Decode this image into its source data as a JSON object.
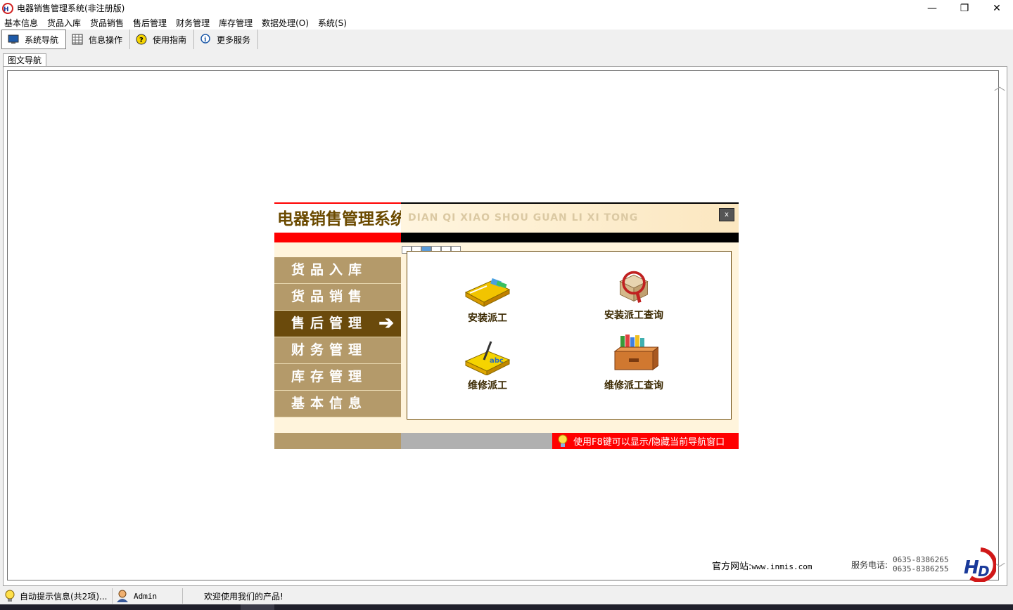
{
  "window": {
    "title": "电器销售管理系统(非注册版)",
    "minimize": "—",
    "restore": "❐",
    "close": "✕"
  },
  "menu": [
    "基本信息",
    "货品入库",
    "货品销售",
    "售后管理",
    "财务管理",
    "库存管理",
    "数据处理(O)",
    "系统(S)"
  ],
  "toolbar": {
    "nav": "系统导航",
    "info": "信息操作",
    "guide": "使用指南",
    "more": "更多服务"
  },
  "tab": {
    "label": "图文导航"
  },
  "navigator": {
    "title": "电器销售管理系统",
    "pinyin": "DIAN QI XIAO SHOU GUAN LI XI TONG",
    "close": "x",
    "menu": [
      "货品入库",
      "货品销售",
      "售后管理",
      "财务管理",
      "库存管理",
      "基本信息"
    ],
    "active_index": 2,
    "arrow": "➔",
    "functions": [
      "安装派工",
      "安装派工查询",
      "维修派工",
      "维修派工查询"
    ],
    "footer_tip": "使用F8键可以显示/隐藏当前导航窗口"
  },
  "site": {
    "label": "官方网站:",
    "url": "www.inmis.com",
    "phone_label": "服务电话:",
    "phone1": "0635-8386265",
    "phone2": "0635-8386255"
  },
  "status": {
    "tips": "自动提示信息(共2项)...",
    "user": "Admin",
    "welcome": "欢迎使用我们的产品!"
  },
  "colors": {
    "accent_red": "#ff0000",
    "nav_brown": "#b49a6a",
    "nav_active": "#6a4a0c"
  }
}
